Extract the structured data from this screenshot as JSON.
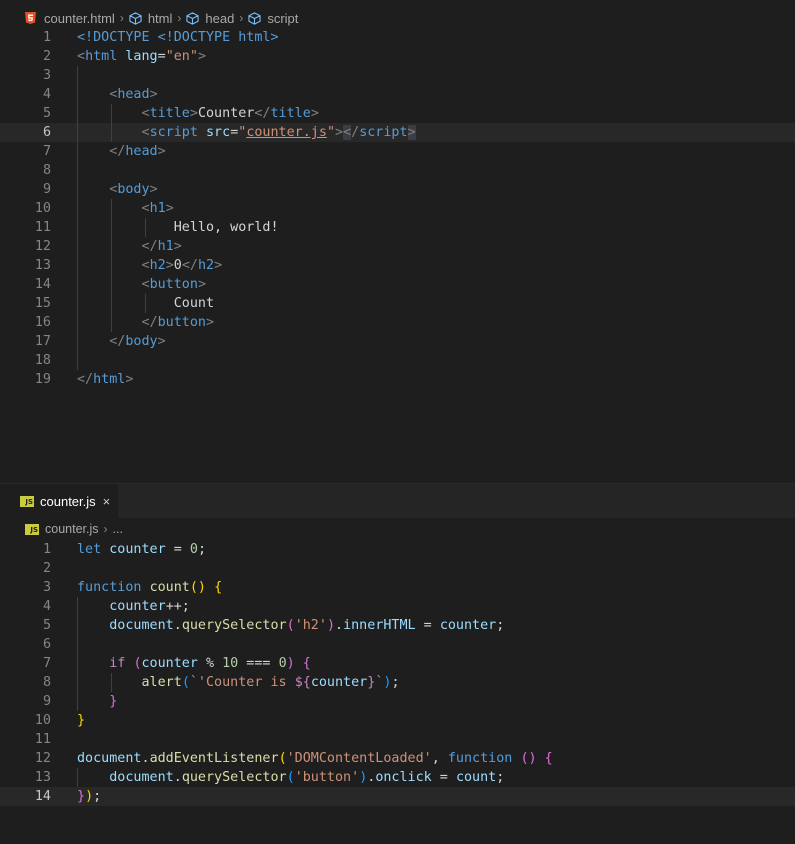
{
  "top_editor": {
    "breadcrumb": {
      "file": "counter.html",
      "segments": [
        "html",
        "head",
        "script"
      ]
    },
    "lines": [
      [
        {
          "t": "<!DOCTYPE <!DOCTYPE html>",
          "c": "tn"
        }
      ],
      [
        {
          "t": "<",
          "c": "tg"
        },
        {
          "t": "html",
          "c": "tn"
        },
        {
          "t": " "
        },
        {
          "t": "lang",
          "c": "at"
        },
        {
          "t": "="
        },
        {
          "t": "\"en\"",
          "c": "st"
        },
        {
          "t": ">",
          "c": "tg"
        }
      ],
      [],
      [
        {
          "t": "    "
        },
        {
          "t": "<",
          "c": "tg"
        },
        {
          "t": "head",
          "c": "tn"
        },
        {
          "t": ">",
          "c": "tg"
        }
      ],
      [
        {
          "t": "        "
        },
        {
          "t": "<",
          "c": "tg"
        },
        {
          "t": "title",
          "c": "tn"
        },
        {
          "t": ">",
          "c": "tg"
        },
        {
          "t": "Counter"
        },
        {
          "t": "</",
          "c": "tg"
        },
        {
          "t": "title",
          "c": "tn"
        },
        {
          "t": ">",
          "c": "tg"
        }
      ],
      [
        {
          "t": "        "
        },
        {
          "t": "<",
          "c": "tg"
        },
        {
          "t": "script",
          "c": "tn"
        },
        {
          "t": " "
        },
        {
          "t": "src",
          "c": "at"
        },
        {
          "t": "="
        },
        {
          "t": "\"",
          "c": "st"
        },
        {
          "t": "counter.js",
          "c": "st ul"
        },
        {
          "t": "\"",
          "c": "st"
        },
        {
          "t": ">",
          "c": "tg"
        },
        {
          "t": "<",
          "c": "tg hl"
        },
        {
          "t": "/",
          "c": "tg"
        },
        {
          "t": "script",
          "c": "tn"
        },
        {
          "t": ">",
          "c": "tg hl"
        }
      ],
      [
        {
          "t": "    "
        },
        {
          "t": "</",
          "c": "tg"
        },
        {
          "t": "head",
          "c": "tn"
        },
        {
          "t": ">",
          "c": "tg"
        }
      ],
      [],
      [
        {
          "t": "    "
        },
        {
          "t": "<",
          "c": "tg"
        },
        {
          "t": "body",
          "c": "tn"
        },
        {
          "t": ">",
          "c": "tg"
        }
      ],
      [
        {
          "t": "        "
        },
        {
          "t": "<",
          "c": "tg"
        },
        {
          "t": "h1",
          "c": "tn"
        },
        {
          "t": ">",
          "c": "tg"
        }
      ],
      [
        {
          "t": "            "
        },
        {
          "t": "Hello, world!"
        }
      ],
      [
        {
          "t": "        "
        },
        {
          "t": "</",
          "c": "tg"
        },
        {
          "t": "h1",
          "c": "tn"
        },
        {
          "t": ">",
          "c": "tg"
        }
      ],
      [
        {
          "t": "        "
        },
        {
          "t": "<",
          "c": "tg"
        },
        {
          "t": "h2",
          "c": "tn"
        },
        {
          "t": ">",
          "c": "tg"
        },
        {
          "t": "0"
        },
        {
          "t": "</",
          "c": "tg"
        },
        {
          "t": "h2",
          "c": "tn"
        },
        {
          "t": ">",
          "c": "tg"
        }
      ],
      [
        {
          "t": "        "
        },
        {
          "t": "<",
          "c": "tg"
        },
        {
          "t": "button",
          "c": "tn"
        },
        {
          "t": ">",
          "c": "tg"
        }
      ],
      [
        {
          "t": "            "
        },
        {
          "t": "Count"
        }
      ],
      [
        {
          "t": "        "
        },
        {
          "t": "</",
          "c": "tg"
        },
        {
          "t": "button",
          "c": "tn"
        },
        {
          "t": ">",
          "c": "tg"
        }
      ],
      [
        {
          "t": "    "
        },
        {
          "t": "</",
          "c": "tg"
        },
        {
          "t": "body",
          "c": "tn"
        },
        {
          "t": ">",
          "c": "tg"
        }
      ],
      [],
      [
        {
          "t": "</",
          "c": "tg"
        },
        {
          "t": "html",
          "c": "tn"
        },
        {
          "t": ">",
          "c": "tg"
        }
      ]
    ]
  },
  "bottom_editor": {
    "tab": {
      "label": "counter.js",
      "close_icon": "×"
    },
    "breadcrumb": {
      "file": "counter.js",
      "more": "..."
    },
    "lines": [
      [
        {
          "t": "let",
          "c": "kw"
        },
        {
          "t": " "
        },
        {
          "t": "counter",
          "c": "vr"
        },
        {
          "t": " = "
        },
        {
          "t": "0",
          "c": "nm"
        },
        {
          "t": ";"
        }
      ],
      [],
      [
        {
          "t": "function",
          "c": "kw"
        },
        {
          "t": " "
        },
        {
          "t": "count",
          "c": "fn"
        },
        {
          "t": "()",
          "c": "br1"
        },
        {
          "t": " "
        },
        {
          "t": "{",
          "c": "br1"
        }
      ],
      [
        {
          "t": "    "
        },
        {
          "t": "counter",
          "c": "vr"
        },
        {
          "t": "++;"
        }
      ],
      [
        {
          "t": "    "
        },
        {
          "t": "document",
          "c": "vr"
        },
        {
          "t": "."
        },
        {
          "t": "querySelector",
          "c": "fn"
        },
        {
          "t": "(",
          "c": "br2"
        },
        {
          "t": "'h2'",
          "c": "st"
        },
        {
          "t": ")",
          "c": "br2"
        },
        {
          "t": "."
        },
        {
          "t": "innerHTML",
          "c": "vr"
        },
        {
          "t": " = "
        },
        {
          "t": "counter",
          "c": "vr"
        },
        {
          "t": ";"
        }
      ],
      [],
      [
        {
          "t": "    "
        },
        {
          "t": "if",
          "c": "ck"
        },
        {
          "t": " "
        },
        {
          "t": "(",
          "c": "br2"
        },
        {
          "t": "counter",
          "c": "vr"
        },
        {
          "t": " % "
        },
        {
          "t": "10",
          "c": "nm"
        },
        {
          "t": " === "
        },
        {
          "t": "0",
          "c": "nm"
        },
        {
          "t": ")",
          "c": "br2"
        },
        {
          "t": " "
        },
        {
          "t": "{",
          "c": "br2"
        }
      ],
      [
        {
          "t": "        "
        },
        {
          "t": "alert",
          "c": "fn"
        },
        {
          "t": "(",
          "c": "br3"
        },
        {
          "t": "`'Counter is ",
          "c": "st"
        },
        {
          "t": "${",
          "c": "ck"
        },
        {
          "t": "counter",
          "c": "vr"
        },
        {
          "t": "}",
          "c": "ck"
        },
        {
          "t": "`",
          "c": "st"
        },
        {
          "t": ")",
          "c": "br3"
        },
        {
          "t": ";"
        }
      ],
      [
        {
          "t": "    "
        },
        {
          "t": "}",
          "c": "br2"
        }
      ],
      [
        {
          "t": "}",
          "c": "br1"
        }
      ],
      [],
      [
        {
          "t": "document",
          "c": "vr"
        },
        {
          "t": "."
        },
        {
          "t": "addEventListener",
          "c": "fn"
        },
        {
          "t": "(",
          "c": "br1"
        },
        {
          "t": "'DOMContentLoaded'",
          "c": "st"
        },
        {
          "t": ", "
        },
        {
          "t": "function",
          "c": "kw"
        },
        {
          "t": " "
        },
        {
          "t": "()",
          "c": "br2"
        },
        {
          "t": " "
        },
        {
          "t": "{",
          "c": "br2"
        }
      ],
      [
        {
          "t": "    "
        },
        {
          "t": "document",
          "c": "vr"
        },
        {
          "t": "."
        },
        {
          "t": "querySelector",
          "c": "fn"
        },
        {
          "t": "(",
          "c": "br3"
        },
        {
          "t": "'button'",
          "c": "st"
        },
        {
          "t": ")",
          "c": "br3"
        },
        {
          "t": "."
        },
        {
          "t": "onclick",
          "c": "vr"
        },
        {
          "t": " = "
        },
        {
          "t": "count",
          "c": "vr"
        },
        {
          "t": ";"
        }
      ],
      [
        {
          "t": "}",
          "c": "br2"
        },
        {
          "t": ")",
          "c": "br1"
        },
        {
          "t": ";"
        }
      ]
    ]
  }
}
